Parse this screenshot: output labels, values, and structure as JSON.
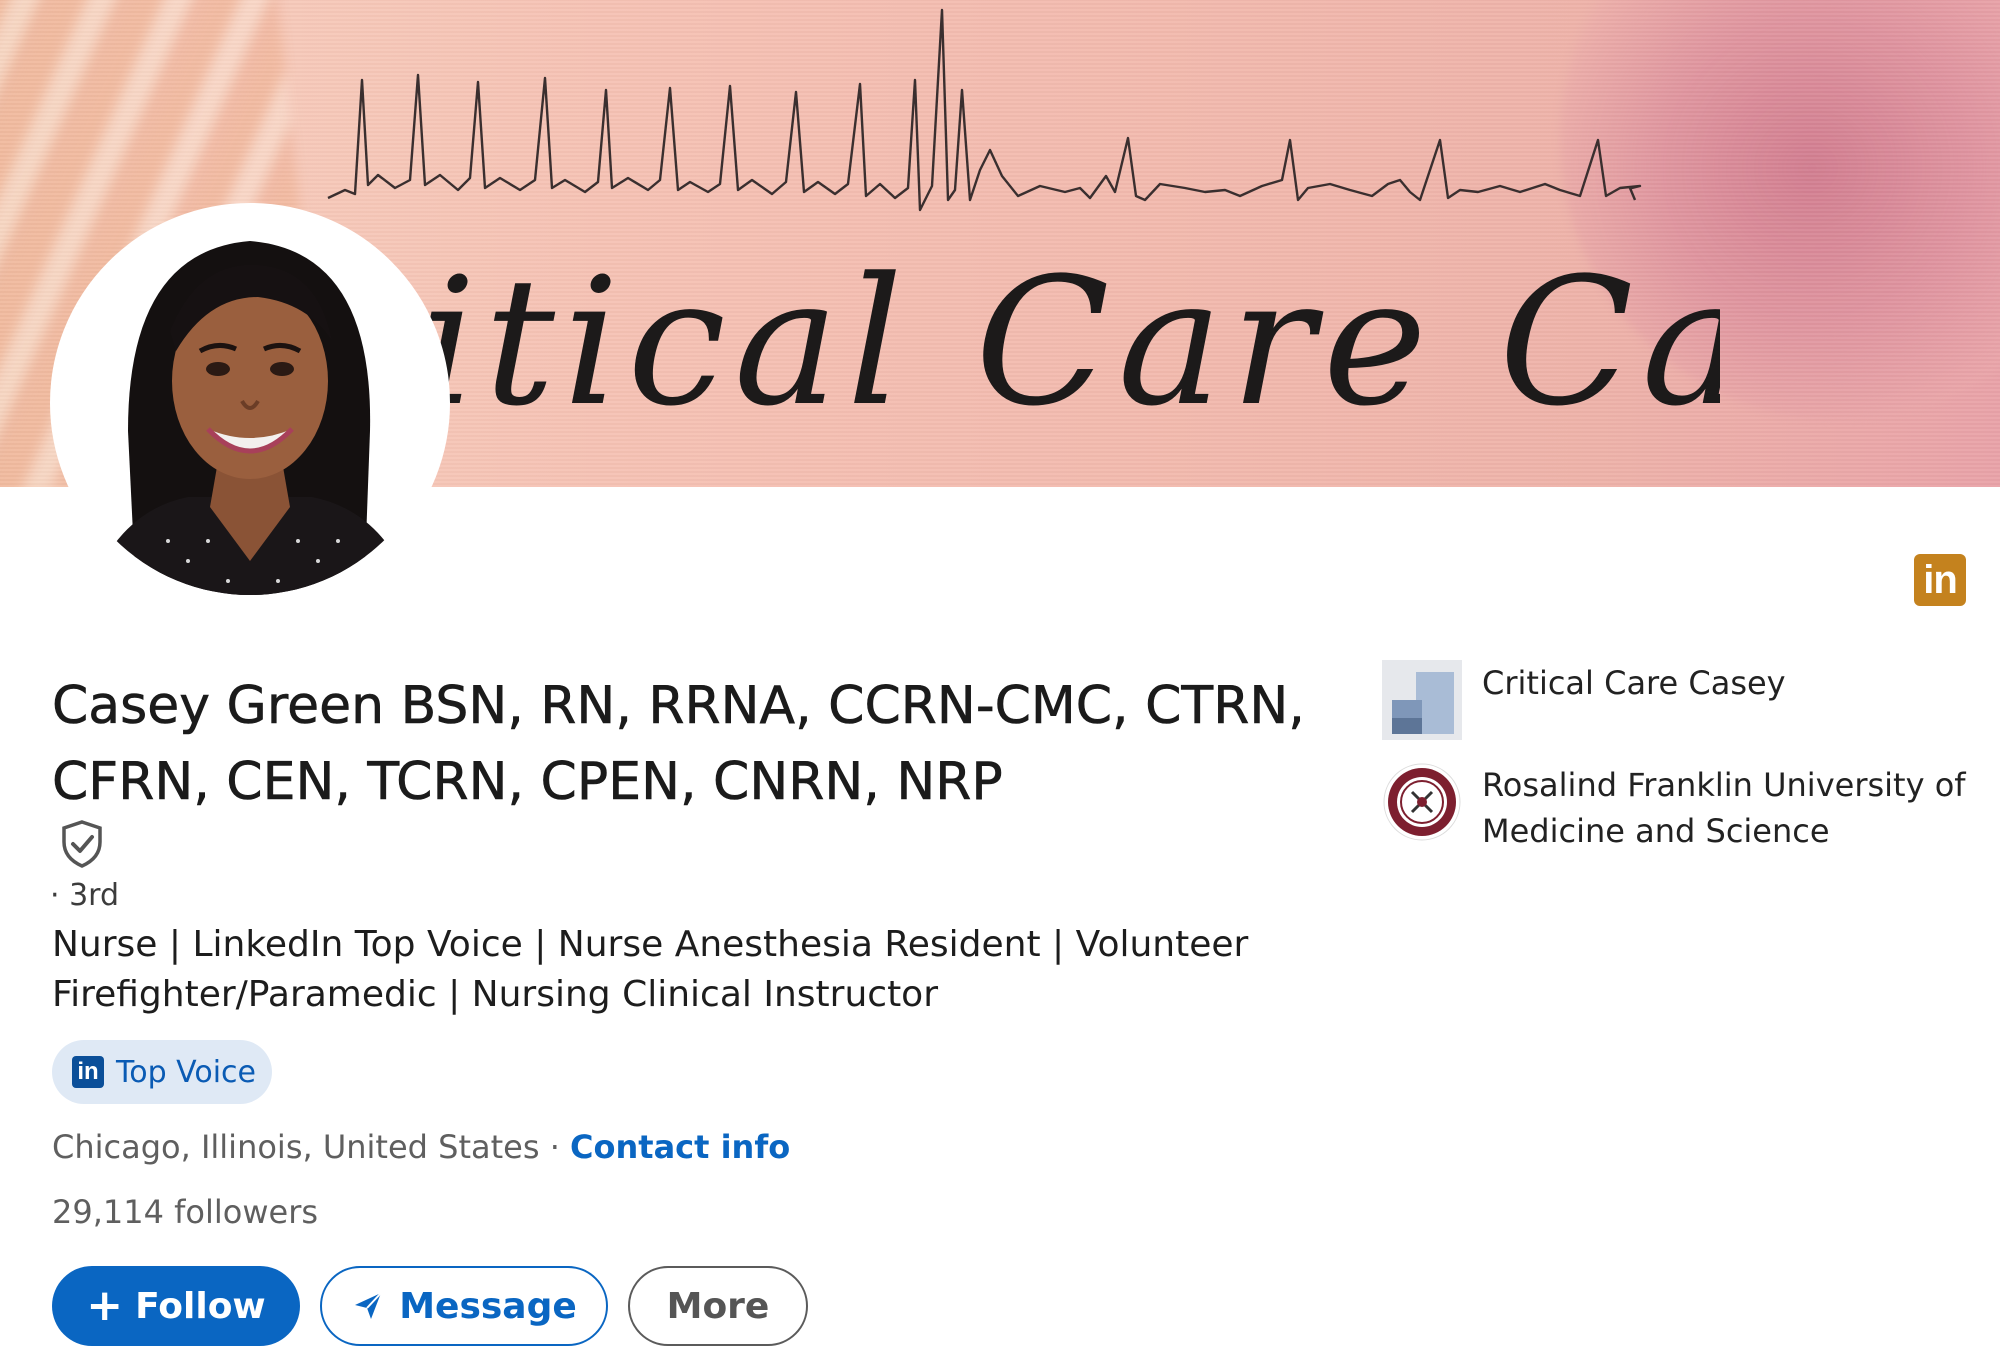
{
  "banner": {
    "title": "itical Care Casey"
  },
  "profile": {
    "name": "Casey Green BSN, RN, RRNA, CCRN-CMC, CTRN, CFRN, CEN, TCRN, CPEN, CNRN, NRP",
    "degree": "· 3rd",
    "headline": "Nurse | LinkedIn Top Voice | Nurse Anesthesia Resident | Volunteer Firefighter/Paramedic | Nursing Clinical Instructor",
    "badge": {
      "icon_text": "in",
      "label": "Top Voice"
    },
    "location": "Chicago, Illinois, United States",
    "separator": "·",
    "contact_label": "Contact info",
    "followers": "29,114 followers"
  },
  "corner_badge_text": "in",
  "actions": {
    "follow_icon": "+",
    "follow_label": "Follow",
    "message_label": "Message",
    "more_label": "More"
  },
  "orgs": [
    {
      "name": "Critical Care Casey",
      "icon": "company-logo-icon"
    },
    {
      "name": "Rosalind Franklin University of Medicine and Science",
      "icon": "university-seal-icon"
    }
  ],
  "colors": {
    "primary": "#0a66c2",
    "badge_bg": "#dfe9f5",
    "corner_badge": "#c4821e",
    "banner_pink": "#f2b9ad"
  }
}
